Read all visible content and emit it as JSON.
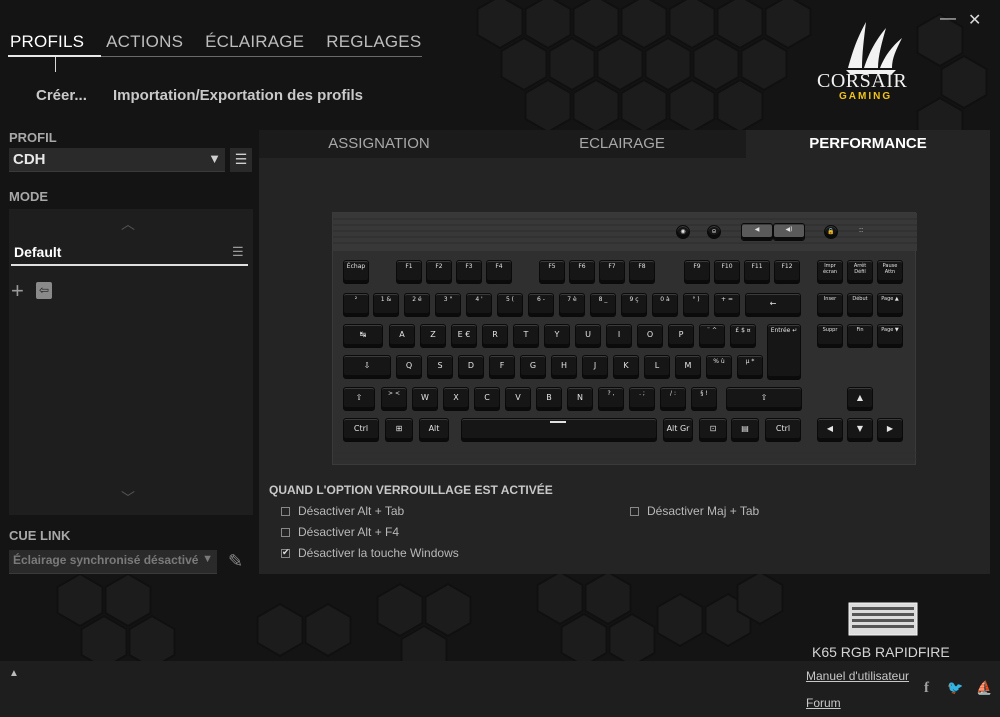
{
  "window": {
    "minimize": "—",
    "close": "✕"
  },
  "topnav": {
    "items": [
      "PROFILS",
      "ACTIONS",
      "ÉCLAIRAGE",
      "REGLAGES"
    ]
  },
  "subnav": {
    "create": "Créer...",
    "import_export": "Importation/Exportation des profils"
  },
  "brand": {
    "name": "CORSAIR",
    "sub": "GAMING",
    "accent": "#f0c419"
  },
  "profile": {
    "label": "PROFIL",
    "value": "CDH",
    "arrow": "▼",
    "menu": "☰"
  },
  "mode": {
    "label": "MODE",
    "up": "︿",
    "down": "﹀",
    "default": "Default",
    "menu": "☰",
    "add": "+",
    "import": "⇦"
  },
  "cue_link": {
    "label": "CUE LINK",
    "value": "Éclairage synchronisé désactivé",
    "arrow": "▼",
    "edit": "✎"
  },
  "tabs": [
    "ASSIGNATION",
    "ECLAIRAGE",
    "PERFORMANCE"
  ],
  "options": {
    "title": "QUAND L'OPTION VERROUILLAGE EST ACTIVÉE",
    "alt_tab": "Désactiver Alt + Tab",
    "alt_f4": "Désactiver Alt + F4",
    "win_key": "Désactiver la touche Windows",
    "shift_tab": "Désactiver Maj + Tab"
  },
  "device": {
    "name": "K65 RGB RAPIDFIRE"
  },
  "footer": {
    "manual": "Manuel d'utilisateur",
    "forum": "Forum",
    "expand": "▲",
    "facebook": "f",
    "twitter": "🐦",
    "corsair": "⛵"
  },
  "keyboard": {
    "media": [
      "◉",
      "⊝",
      "◀",
      "◀)",
      "🔒",
      "∶∶"
    ],
    "row_fn": [
      "Échap",
      "F1",
      "F2",
      "F3",
      "F4",
      "F5",
      "F6",
      "F7",
      "F8",
      "F9",
      "F10",
      "F11",
      "F12",
      "Impr écran",
      "Arrêt Défil",
      "Pause Attn"
    ],
    "row_num": [
      "²",
      "1 &",
      "2 é",
      "3 \"",
      "4 '",
      "5 (",
      "6 -",
      "7 è",
      "8 _",
      "9 ç",
      "0 à",
      "° )",
      "+ =",
      "←",
      "Inser",
      "Début",
      "Page ▲"
    ],
    "row_q": [
      "↹",
      "A",
      "Z",
      "E €",
      "R",
      "T",
      "Y",
      "U",
      "I",
      "O",
      "P",
      "¨ ^",
      "£ $ ¤",
      "Entrée ↵",
      "Suppr",
      "Fin",
      "Page ▼"
    ],
    "row_a": [
      "⇩",
      "Q",
      "S",
      "D",
      "F",
      "G",
      "H",
      "J",
      "K",
      "L",
      "M",
      "% ù",
      "µ *"
    ],
    "row_w": [
      "⇧",
      "> <",
      "W",
      "X",
      "C",
      "V",
      "B",
      "N",
      "? ,",
      ". ;",
      "/ :",
      "§ !",
      "⇧",
      "▲"
    ],
    "row_ctrl": [
      "Ctrl",
      "⊞",
      "Alt",
      "",
      "Alt Gr",
      "⊡",
      "▤",
      "Ctrl",
      "◀",
      "▼",
      "▶"
    ]
  }
}
